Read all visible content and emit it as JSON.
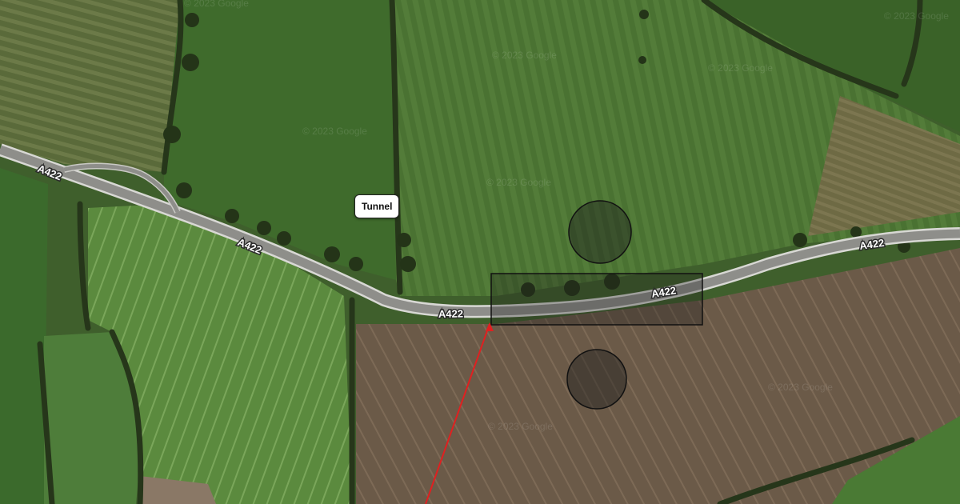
{
  "map": {
    "type": "satellite-imagery",
    "road_name": "A422",
    "road_labels": [
      "A422",
      "A422",
      "A422",
      "A422",
      "A422"
    ],
    "poi_label": "Tunnel",
    "watermark": "© 2023 Google",
    "overlays": {
      "circle_color": "rgba(30,30,30,0.45)",
      "rectangle_color": "rgba(30,30,30,0.30)",
      "line_color": "#e02020"
    },
    "colors": {
      "field_green_dark": "#3b5a2a",
      "field_green": "#4f7a36",
      "field_green_light": "#5d8a3e",
      "field_brown": "#6e5d4a",
      "road": "#9a9a96",
      "hedge": "#2a3a1c"
    }
  }
}
